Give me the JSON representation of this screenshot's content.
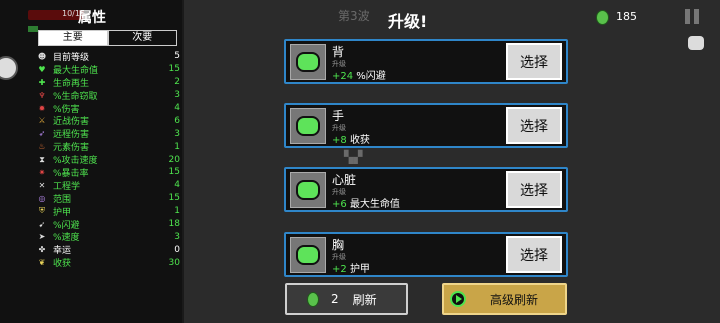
{
  "stats_panel": {
    "title": "属性",
    "hp_text": "10/15",
    "tabs": [
      {
        "label": "主要",
        "active": true
      },
      {
        "label": "次要",
        "active": false
      }
    ],
    "rows": [
      {
        "icon": "level-icon",
        "label": "目前等级",
        "value": "5",
        "color": "white"
      },
      {
        "icon": "heart-icon",
        "label": "最大生命值",
        "value": "15",
        "color": "green"
      },
      {
        "icon": "regen-icon",
        "label": "生命再生",
        "value": "2",
        "color": "green"
      },
      {
        "icon": "lifesteal-icon",
        "label": "%生命窃取",
        "value": "3",
        "color": "green"
      },
      {
        "icon": "damage-icon",
        "label": "%伤害",
        "value": "4",
        "color": "green"
      },
      {
        "icon": "melee-icon",
        "label": "近战伤害",
        "value": "6",
        "color": "green"
      },
      {
        "icon": "ranged-icon",
        "label": "远程伤害",
        "value": "3",
        "color": "green"
      },
      {
        "icon": "elemental-icon",
        "label": "元素伤害",
        "value": "1",
        "color": "green"
      },
      {
        "icon": "attack-speed-icon",
        "label": "%攻击速度",
        "value": "20",
        "color": "green"
      },
      {
        "icon": "crit-icon",
        "label": "%暴击率",
        "value": "15",
        "color": "green"
      },
      {
        "icon": "engineering-icon",
        "label": "工程学",
        "value": "4",
        "color": "green"
      },
      {
        "icon": "range-icon",
        "label": "范围",
        "value": "15",
        "color": "green"
      },
      {
        "icon": "armor-icon",
        "label": "护甲",
        "value": "1",
        "color": "green"
      },
      {
        "icon": "dodge-icon",
        "label": "%闪避",
        "value": "18",
        "color": "green"
      },
      {
        "icon": "speed-icon",
        "label": "%速度",
        "value": "3",
        "color": "green"
      },
      {
        "icon": "luck-icon",
        "label": "幸运",
        "value": "0",
        "color": "white"
      },
      {
        "icon": "harvest-icon",
        "label": "收获",
        "value": "30",
        "color": "green"
      }
    ]
  },
  "header": {
    "wave": "第3波",
    "title": "升级!",
    "coins": "185"
  },
  "cards": [
    {
      "name": "背",
      "tag": "升级",
      "amount": "+24",
      "effect": "%闪避",
      "button": "选择",
      "icon": "back-armor-icon"
    },
    {
      "name": "手",
      "tag": "升级",
      "amount": "+8",
      "effect": "收获",
      "button": "选择",
      "icon": "hand-icon"
    },
    {
      "name": "心脏",
      "tag": "升级",
      "amount": "+6",
      "effect": "最大生命值",
      "button": "选择",
      "icon": "heart-organ-icon"
    },
    {
      "name": "胸",
      "tag": "升级",
      "amount": "+2",
      "effect": "护甲",
      "button": "选择",
      "icon": "chest-armor-icon"
    }
  ],
  "footer": {
    "reroll_cost": "2",
    "reroll_label": "刷新",
    "advanced_reroll_label": "高级刷新"
  },
  "colors": {
    "card_border": "#2f86c9",
    "stat_green": "#4ee44e",
    "advanced_button": "#c9a548"
  }
}
